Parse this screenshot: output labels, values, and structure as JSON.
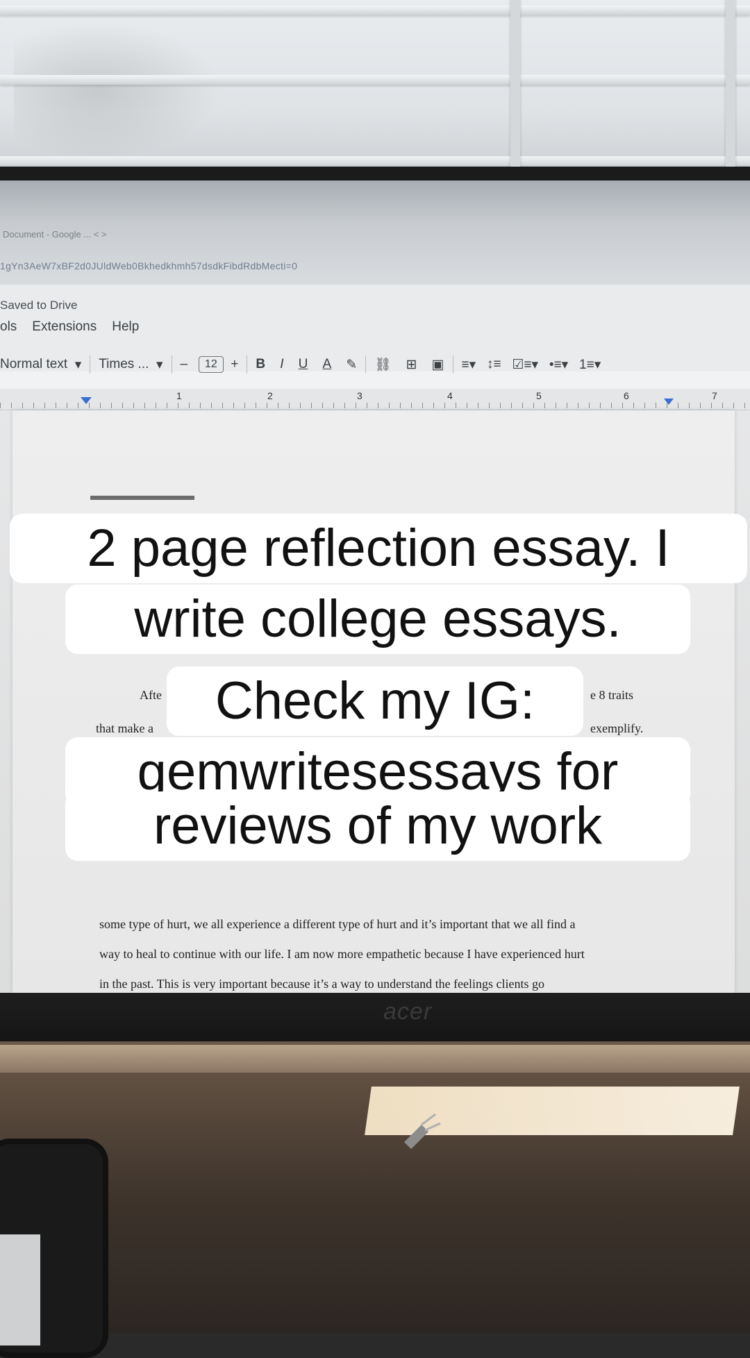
{
  "browser": {
    "tab_text": "Document - Google ...   <   >",
    "url_text": "1gYn3AeW7xBF2d0JUldWeb0Bkhedkhmh57dsdkFibdRdbMecti=0"
  },
  "doc": {
    "saved_status": "Saved to Drive",
    "menu": [
      "ols",
      "Extensions",
      "Help"
    ],
    "toolbar": {
      "style": "Normal text",
      "font": "Times ...",
      "minus": "–",
      "font_size": "12",
      "plus": "+",
      "bold": "B",
      "italic": "I",
      "underline": "U",
      "text_color": "A"
    },
    "ruler_numbers": [
      "1",
      "2",
      "3",
      "4",
      "5",
      "6",
      "7"
    ],
    "body_fragments": {
      "left_1": "Afte",
      "right_1": "e 8 traits",
      "left_2": "that make a",
      "right_2": "exemplify."
    },
    "body_lines": [
      "some type of hurt, we all experience a different type of hurt and it’s important that we all find a",
      "way to heal to continue with our life. I am now more empathetic because I have experienced hurt",
      "in the past. This is very important because it’s a way to understand the feelings clients go"
    ]
  },
  "monitor": {
    "brand": "acer"
  },
  "caption": {
    "lines": [
      "2 page reflection essay. I",
      "write college essays.",
      "Check my IG:",
      "gemwritesessays for",
      "reviews of my work"
    ]
  },
  "colors": {
    "caption_bg": "#ffffff",
    "caption_text": "#111111",
    "ruler_marker": "#3b6fd1"
  }
}
